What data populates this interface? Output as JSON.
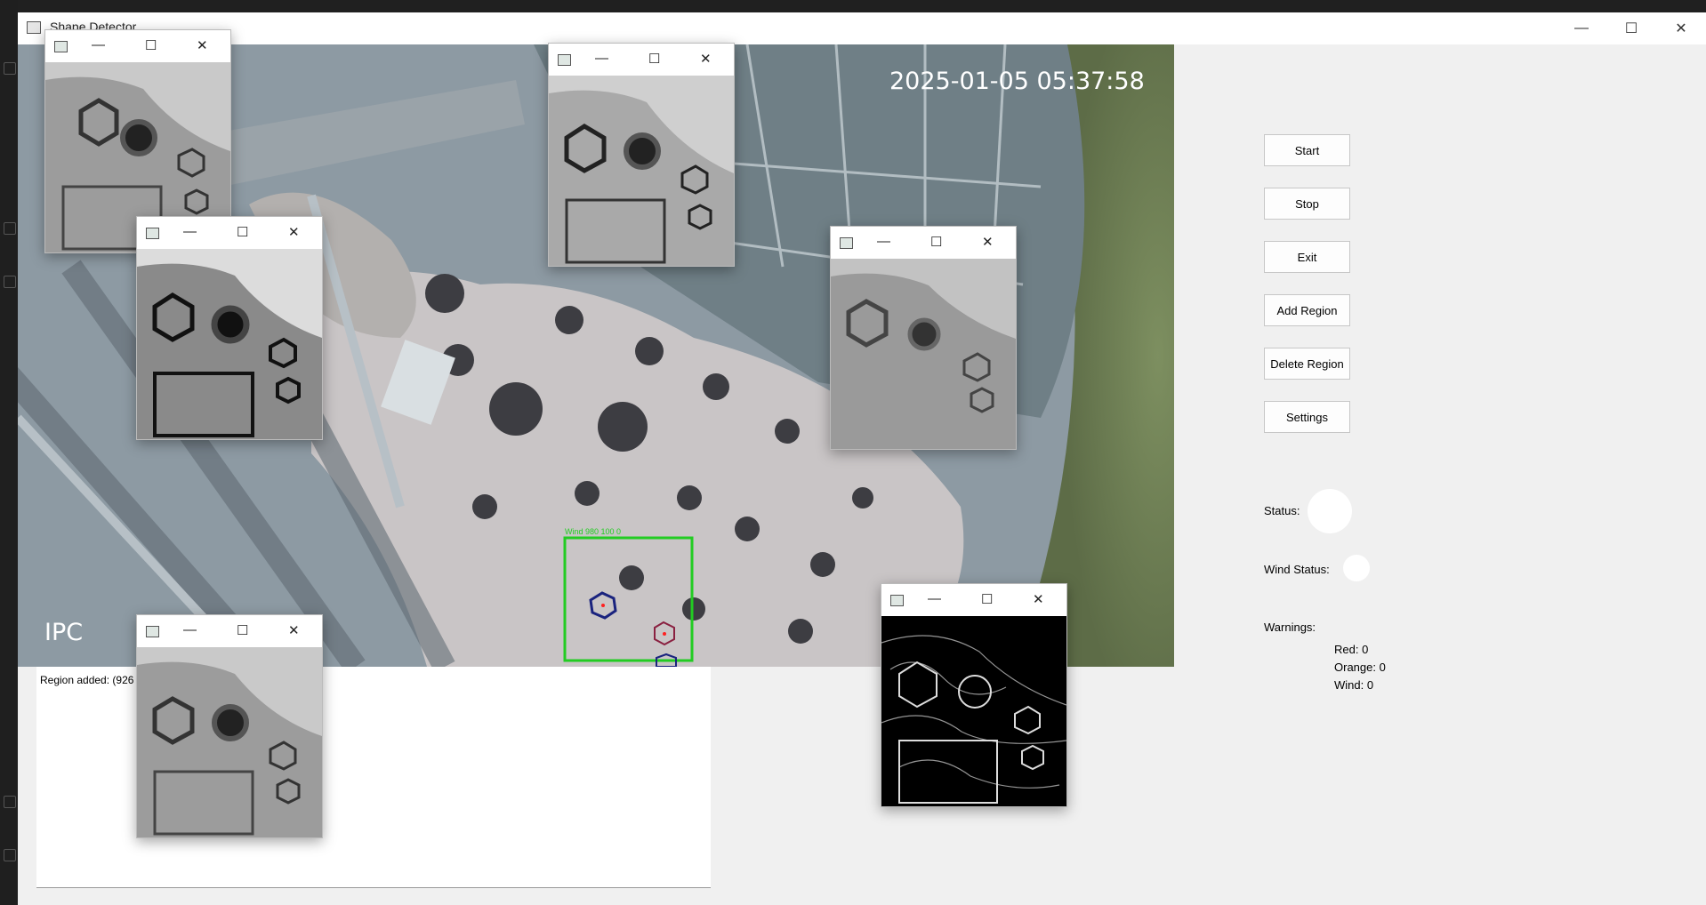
{
  "window": {
    "title": "Shape Detector",
    "minimize": "—",
    "maximize": "☐",
    "close": "✕"
  },
  "feed": {
    "timestamp": "2025-01-05 05:37:58",
    "camera_label": "IPC"
  },
  "log": {
    "first_line": "Region added: (926"
  },
  "controls": {
    "start": "Start",
    "stop": "Stop",
    "exit": "Exit",
    "add_region": "Add Region",
    "delete_region": "Delete Region",
    "settings": "Settings"
  },
  "status": {
    "status_label": "Status:",
    "wind_label": "Wind Status:"
  },
  "warnings": {
    "label": "Warnings:",
    "red": "Red: 0",
    "orange": "Orange: 0",
    "wind": "Wind: 0"
  },
  "subwindow": {
    "minimize": "—",
    "maximize": "☐",
    "close": "✕"
  },
  "colors": {
    "region_box": "#22cc22",
    "hexagon_outline": "#1a237e",
    "status_indicator": "#ffffff"
  }
}
